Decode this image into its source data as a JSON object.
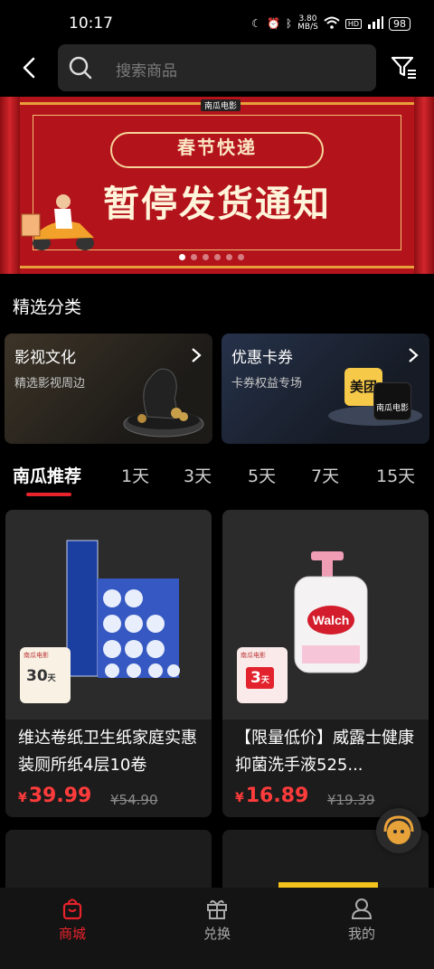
{
  "status": {
    "time": "10:17",
    "speed_value": "3.80",
    "speed_unit": "MB/S",
    "hd": "HD",
    "battery": "98"
  },
  "search": {
    "placeholder": "搜索商品"
  },
  "banner": {
    "logo": "南瓜电影",
    "subtitle": "春节快递",
    "title": "暂停发货通知",
    "slide_count": 6,
    "active_slide": 0
  },
  "section_title": "精选分类",
  "categories": [
    {
      "title": "影视文化",
      "subtitle": "精选影视周边"
    },
    {
      "title": "优惠卡券",
      "subtitle": "卡券权益专场",
      "logos": [
        "美团",
        "南瓜电影"
      ]
    }
  ],
  "tabs": [
    "南瓜推荐",
    "1天",
    "3天",
    "5天",
    "7天",
    "15天"
  ],
  "products": [
    {
      "name": "维达卷纸卫生纸家庭实惠装厕所纸4层10卷",
      "currency": "¥",
      "price": "39.99",
      "old_price": "¥54.90",
      "days": "30",
      "days_unit": "天",
      "badge_logo": "南瓜电影"
    },
    {
      "name": "【限量低价】威露士健康抑菌洗手液525...",
      "currency": "¥",
      "price": "16.89",
      "old_price": "¥19.39",
      "days": "3",
      "days_unit": "天",
      "badge_logo": "南瓜电影"
    }
  ],
  "nav": [
    {
      "label": "商城"
    },
    {
      "label": "兑换"
    },
    {
      "label": "我的"
    }
  ],
  "colors": {
    "accent": "#e8232c",
    "price": "#ff3b3b",
    "banner_red": "#b3131a"
  }
}
